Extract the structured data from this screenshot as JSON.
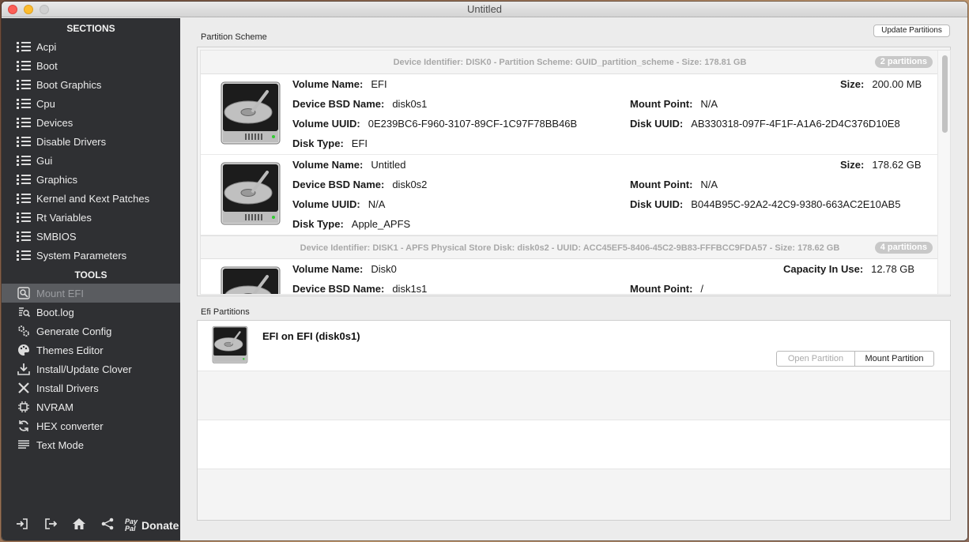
{
  "window": {
    "title": "Untitled"
  },
  "sidebar": {
    "sections_header": "SECTIONS",
    "sections": [
      {
        "label": "Acpi"
      },
      {
        "label": "Boot"
      },
      {
        "label": "Boot Graphics"
      },
      {
        "label": "Cpu"
      },
      {
        "label": "Devices"
      },
      {
        "label": "Disable Drivers"
      },
      {
        "label": "Gui"
      },
      {
        "label": "Graphics"
      },
      {
        "label": "Kernel and Kext Patches"
      },
      {
        "label": "Rt Variables"
      },
      {
        "label": "SMBIOS"
      },
      {
        "label": "System Parameters"
      }
    ],
    "tools_header": "TOOLS",
    "tools": [
      {
        "label": "Mount EFI",
        "icon": "mount-efi-icon"
      },
      {
        "label": "Boot.log",
        "icon": "boot-log-icon"
      },
      {
        "label": "Generate Config",
        "icon": "gears-icon"
      },
      {
        "label": "Themes Editor",
        "icon": "palette-icon"
      },
      {
        "label": "Install/Update Clover",
        "icon": "download-icon"
      },
      {
        "label": "Install Drivers",
        "icon": "tools-icon"
      },
      {
        "label": "NVRAM",
        "icon": "chip-icon"
      },
      {
        "label": "HEX converter",
        "icon": "refresh-icon"
      },
      {
        "label": "Text Mode",
        "icon": "text-lines-icon"
      }
    ],
    "selected_tool": "Mount EFI",
    "bottom": {
      "donate_label": "Donate",
      "paypal_line1": "Pay",
      "paypal_line2": "Pal"
    }
  },
  "main": {
    "update_partitions_label": "Update Partitions",
    "partition_scheme_label": "Partition Scheme",
    "efi_partitions_label": "Efi Partitions",
    "field_labels": {
      "volume_name": "Volume Name:",
      "device_bsd_name": "Device BSD Name:",
      "volume_uuid": "Volume UUID:",
      "disk_type": "Disk Type:",
      "size": "Size:",
      "mount_point": "Mount Point:",
      "disk_uuid": "Disk UUID:",
      "capacity_in_use": "Capacity In Use:"
    },
    "devices": [
      {
        "header": "Device Identifier: DISK0 - Partition Scheme: GUID_partition_scheme - Size: 178.81 GB",
        "badge": "2 partitions",
        "volumes": [
          {
            "volume_name": "EFI",
            "device_bsd_name": "disk0s1",
            "volume_uuid": "0E239BC6-F960-3107-89CF-1C97F78BB46B",
            "disk_type": "EFI",
            "size": "200.00 MB",
            "mount_point": "N/A",
            "disk_uuid": "AB330318-097F-4F1F-A1A6-2D4C376D10E8"
          },
          {
            "volume_name": "Untitled",
            "device_bsd_name": "disk0s2",
            "volume_uuid": "N/A",
            "disk_type": "Apple_APFS",
            "size": "178.62 GB",
            "mount_point": "N/A",
            "disk_uuid": "B044B95C-92A2-42C9-9380-663AC2E10AB5"
          }
        ]
      },
      {
        "header": "Device Identifier: DISK1 - APFS Physical Store Disk: disk0s2 - UUID: ACC45EF5-8406-45C2-9B83-FFFBCC9FDA57 - Size: 178.62 GB",
        "badge": "4 partitions",
        "volumes": [
          {
            "volume_name": "Disk0",
            "device_bsd_name": "disk1s1",
            "capacity_in_use": "12.78 GB",
            "mount_point": "/"
          }
        ]
      }
    ],
    "efi": {
      "title": "EFI on EFI (disk0s1)",
      "open_label": "Open Partition",
      "mount_label": "Mount Partition"
    }
  }
}
